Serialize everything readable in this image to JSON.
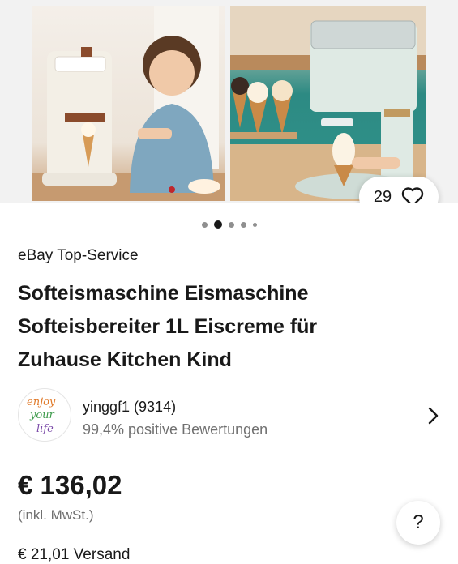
{
  "gallery": {
    "likes_count": "29",
    "dot_count": 5,
    "active_dot": 1
  },
  "listing": {
    "service_label": "eBay Top-Service",
    "title_lines": [
      "Softeismaschine Eismaschine",
      "Softeisbereiter 1L Eiscreme für",
      "Zuhause Kitchen Kind"
    ]
  },
  "seller": {
    "name": "yinggf1 (9314)",
    "rating": "99,4% positive Bewertungen",
    "avatar_text": [
      "enjoy",
      "your",
      "life"
    ]
  },
  "pricing": {
    "price": "€ 136,02",
    "vat_note": "(inkl. MwSt.)",
    "shipping": "€ 21,01 Versand"
  },
  "help": {
    "label": "?"
  },
  "icons": {
    "like": "heart-icon",
    "seller_chevron": "chevron-right-icon"
  }
}
